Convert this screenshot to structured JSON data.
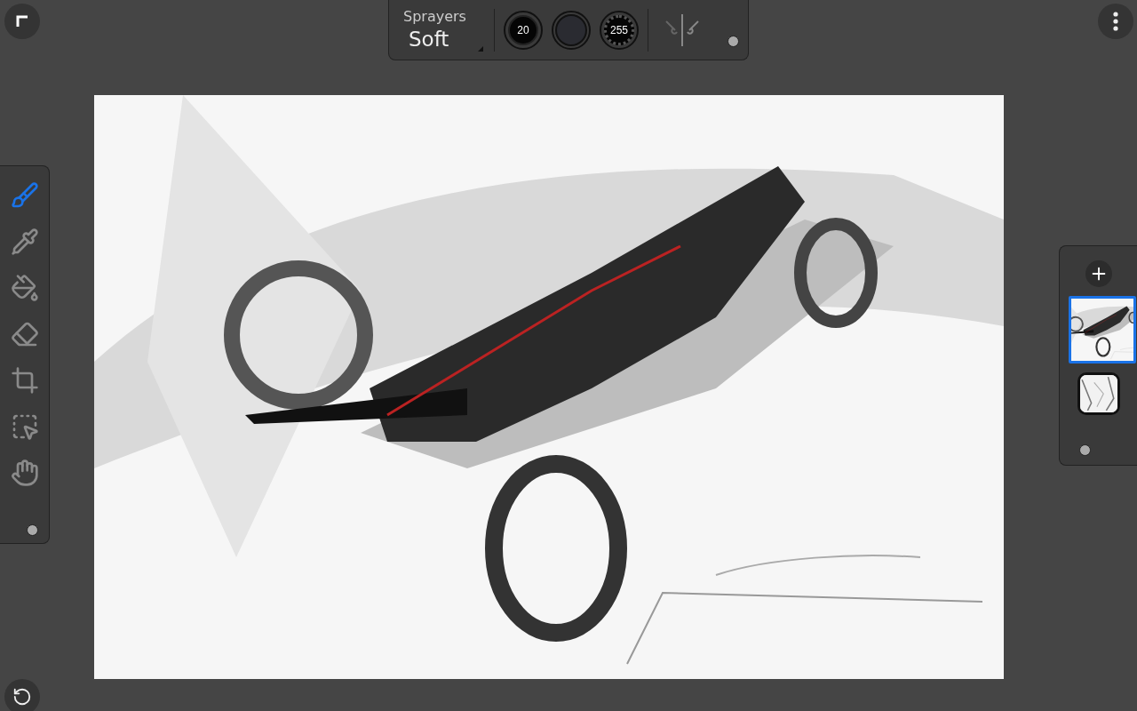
{
  "brush_toolbar": {
    "category": "Sprayers",
    "brush": "Soft",
    "size": "20",
    "opacity": "255"
  },
  "tools": [
    {
      "kind": "brush",
      "selected": true
    },
    {
      "kind": "eyedropper",
      "selected": false
    },
    {
      "kind": "fill",
      "selected": false
    },
    {
      "kind": "eraser",
      "selected": false
    },
    {
      "kind": "crop",
      "selected": false
    },
    {
      "kind": "select",
      "selected": false
    },
    {
      "kind": "hand",
      "selected": false
    }
  ],
  "layers": [
    {
      "kind": "sketch",
      "selected": true
    },
    {
      "kind": "paper",
      "selected": false
    }
  ]
}
